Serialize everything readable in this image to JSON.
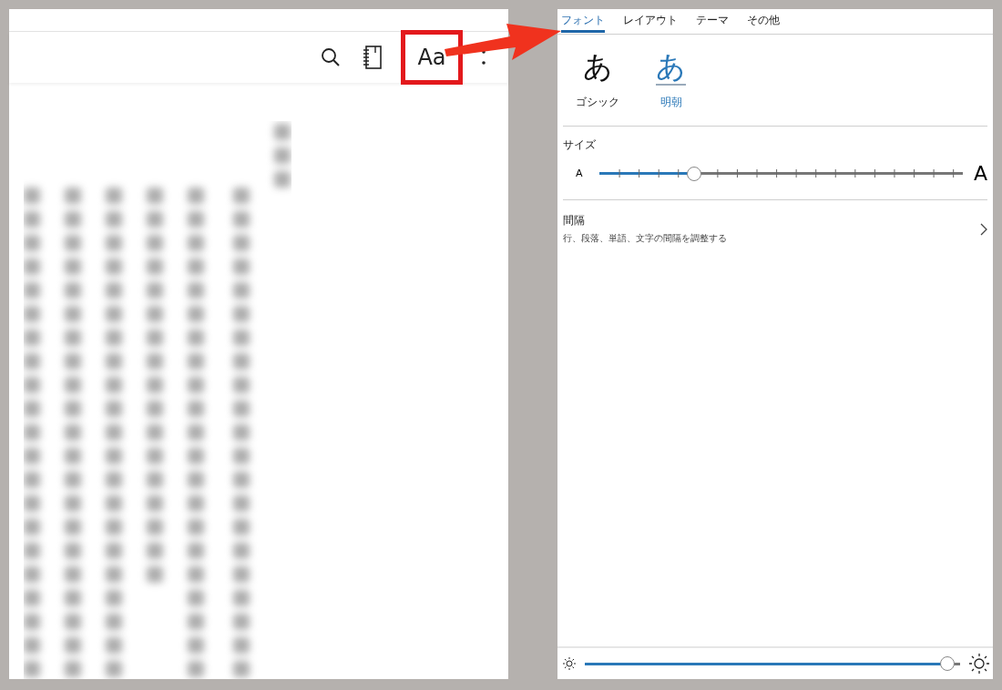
{
  "reader": {
    "toolbar": {
      "font_button": "Aa",
      "font_button_highlighted": true
    }
  },
  "settings": {
    "tabs": [
      {
        "label": "フォント",
        "selected": true
      },
      {
        "label": "レイアウト",
        "selected": false
      },
      {
        "label": "テーマ",
        "selected": false
      },
      {
        "label": "その他",
        "selected": false
      }
    ],
    "fonts": [
      {
        "sample": "あ",
        "label": "ゴシック",
        "selected": false
      },
      {
        "sample": "あ",
        "label": "明朝",
        "selected": true
      }
    ],
    "size": {
      "label": "サイズ",
      "small_label": "A",
      "large_label": "A",
      "level": 0.26
    },
    "spacing": {
      "title": "間隔",
      "description": "行、段落、単語、文字の間隔を調整する"
    },
    "brightness": {
      "level": 0.965
    }
  }
}
